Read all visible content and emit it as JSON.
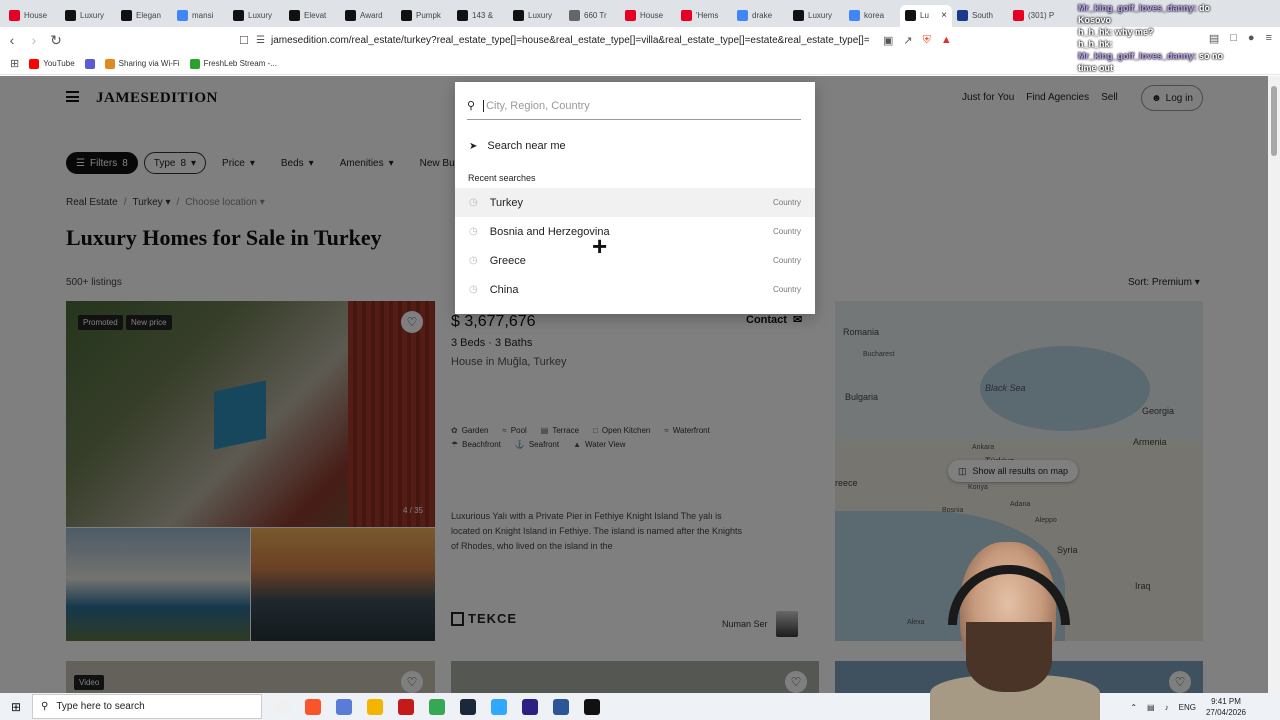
{
  "browser": {
    "tabs": [
      {
        "title": "House",
        "color": "#e60023"
      },
      {
        "title": "Luxury",
        "color": "#111111"
      },
      {
        "title": "Elegan",
        "color": "#111111"
      },
      {
        "title": "mansi",
        "color": "#4285f4"
      },
      {
        "title": "Luxury",
        "color": "#111111"
      },
      {
        "title": "Elevat",
        "color": "#111111"
      },
      {
        "title": "Award",
        "color": "#111111"
      },
      {
        "title": "Pumpk",
        "color": "#111111"
      },
      {
        "title": "143 &",
        "color": "#111111"
      },
      {
        "title": "Luxury",
        "color": "#111111"
      },
      {
        "title": "660 Tr",
        "color": "#666666"
      },
      {
        "title": "House",
        "color": "#e60023"
      },
      {
        "title": "'Hems",
        "color": "#e60023"
      },
      {
        "title": "drake",
        "color": "#4285f4"
      },
      {
        "title": "Luxury",
        "color": "#111111"
      },
      {
        "title": "korea",
        "color": "#4285f4"
      },
      {
        "title": "Lu",
        "color": "#111111",
        "active": true
      },
      {
        "title": "South",
        "color": "#1a3a8a"
      },
      {
        "title": "(301) P",
        "color": "#e60023"
      }
    ],
    "url": "jamesedition.com/real_estate/turkey?real_estate_type[]=house&real_estate_type[]=villa&real_estate_type[]=estate&real_estate_type[]=country_...",
    "bookmarks": [
      {
        "label": "YouTube",
        "color": "#ff0000"
      },
      {
        "label": "",
        "color": "#5b5bd6"
      },
      {
        "label": "Sharing via Wi-Fi",
        "color": "#e08a1e"
      },
      {
        "label": "FreshLeb Stream -...",
        "color": "#2ca02c"
      }
    ]
  },
  "site": {
    "logo": "JAMESEDITION",
    "header_links": [
      "Just for You",
      "Find Agencies",
      "Sell"
    ],
    "login": "Log in",
    "filters": [
      {
        "label": "Filters",
        "count": "8"
      },
      {
        "label": "Type",
        "count": "8"
      },
      {
        "label": "Price"
      },
      {
        "label": "Beds"
      },
      {
        "label": "Amenities"
      },
      {
        "label": "New Bu"
      }
    ],
    "breadcrumb": [
      "Real Estate",
      "Turkey",
      "Choose location"
    ],
    "title": "Luxury Homes for Sale in Turkey",
    "count": "500+ listings",
    "sort": "Sort: Premium"
  },
  "listing": {
    "badges": [
      "Promoted",
      "New price"
    ],
    "photo_count": "4 / 35",
    "price": "$ 3,677,676",
    "contact": "Contact",
    "beds_baths": "3 Beds · 3 Baths",
    "location": "House in Muğla, Turkey",
    "features": [
      "Garden",
      "Pool",
      "Terrace",
      "Open Kitchen",
      "Waterfront",
      "Beachfront",
      "Seafront",
      "Water View"
    ],
    "description": "Luxurious Yalı with a Private Pier in Fethiye Knight Island The yalı is located on Knight Island in Fethiye. The island is named after the Knights of Rhodes, who lived on the island in the",
    "agency": "TEKCE",
    "agent": "Numan Ser",
    "next_badge": "Video"
  },
  "map": {
    "button": "Show all results on map",
    "labels": [
      "Romania",
      "Bucharest",
      "Black Sea",
      "Georgia",
      "Bulgaria",
      "Armenia",
      "Ankara",
      "Türkiye",
      "reece",
      "Konya",
      "Bosnia",
      "Adana",
      "Aleppo",
      "Syria",
      "Iraq",
      "Alexa"
    ]
  },
  "search": {
    "placeholder": "City, Region, Country",
    "near_me": "Search near me",
    "recent_heading": "Recent searches",
    "recent": [
      {
        "name": "Turkey",
        "type": "Country"
      },
      {
        "name": "Bosnia and Herzegovina",
        "type": "Country"
      },
      {
        "name": "Greece",
        "type": "Country"
      },
      {
        "name": "China",
        "type": "Country"
      }
    ]
  },
  "stream_chat": [
    {
      "user": "Mr_king_golf_loves_danny:",
      "text": "do"
    },
    {
      "user": "",
      "text": "Kosovo"
    },
    {
      "user": "",
      "text": "h_h_hk: why me?"
    },
    {
      "user": "",
      "text": "h_h_hk:"
    },
    {
      "user": "Mr_king_golf_loves_danny:",
      "text": "so no"
    },
    {
      "user": "",
      "text": "time out"
    }
  ],
  "taskbar": {
    "search": "Type here to search",
    "lang": "ENG",
    "time": "9:41 PM",
    "date": "27/04/2026",
    "apps": [
      "#f0f0f0",
      "#fb542b",
      "#5a7bd6",
      "#f4b400",
      "#c41a1a",
      "#34a853",
      "#1b2838",
      "#31a8ff",
      "#2e1f83",
      "#2b5797",
      "#111111"
    ]
  }
}
